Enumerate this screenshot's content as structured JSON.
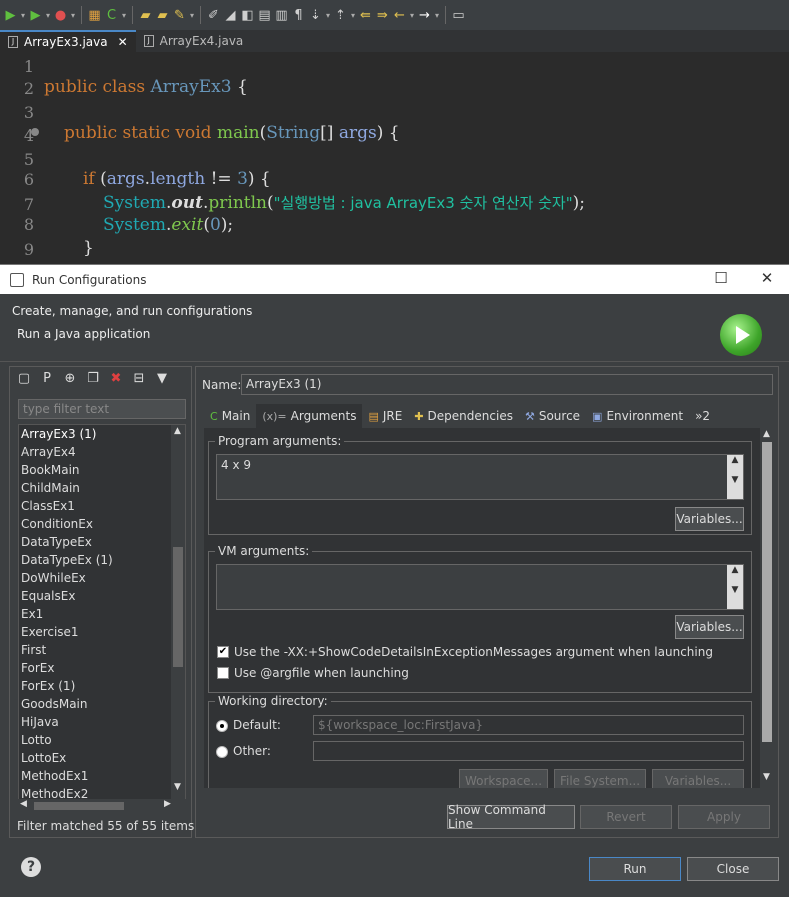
{
  "editor_tabs": [
    {
      "label": "ArrayEx3.java",
      "active": true,
      "close": "✕"
    },
    {
      "label": "ArrayEx4.java",
      "active": false
    }
  ],
  "code_lines": [
    "1",
    "2",
    "3",
    "4",
    "5",
    "6",
    "7",
    "8",
    "9"
  ],
  "code": {
    "l2_kw": "public class ",
    "l2_cls": "ArrayEx3",
    "l2_rest": " {",
    "l4_kw": "public static void ",
    "l4_fn": "main",
    "l4_p1": "(",
    "l4_type": "String",
    "l4_p2": "[] ",
    "l4_var": "args",
    "l4_p3": ") {",
    "l6_kw": "if ",
    "l6_p1": "(",
    "l6_var": "args",
    "l6_p2": ".",
    "l6_field": "length",
    "l6_op": " != ",
    "l6_num": "3",
    "l6_p3": ") {",
    "l7_cls": "System",
    "l7_d1": ".",
    "l7_out": "out",
    "l7_d2": ".",
    "l7_fn": "println",
    "l7_p1": "(",
    "l7_str": "\"실행방법 : java ArrayEx3 숫자 연산자 숫자\"",
    "l7_p2": ");",
    "l8_cls": "System",
    "l8_d": ".",
    "l8_fn": "exit",
    "l8_p1": "(",
    "l8_num": "0",
    "l8_p2": ");",
    "l9": "}"
  },
  "dialog": {
    "title": "Run Configurations",
    "header_title": "Create, manage, and run configurations",
    "header_sub": "Run a Java application",
    "filter_placeholder": "type filter text",
    "configs": [
      "ArrayEx3 (1)",
      "ArrayEx4",
      "BookMain",
      "ChildMain",
      "ClassEx1",
      "ConditionEx",
      "DataTypeEx",
      "DataTypeEx (1)",
      "DoWhileEx",
      "EqualsEx",
      "Ex1",
      "Exercise1",
      "First",
      "ForEx",
      "ForEx (1)",
      "GoodsMain",
      "HiJava",
      "Lotto",
      "LottoEx",
      "MethodEx1",
      "MethodEx2"
    ],
    "filter_status": "Filter matched 55 of 55 items",
    "name_label": "Name:",
    "name_value": "ArrayEx3 (1)",
    "tabs": [
      {
        "label": "Main",
        "icon": "C"
      },
      {
        "label": "Arguments",
        "icon": "(x)="
      },
      {
        "label": "JRE",
        "icon": "▤"
      },
      {
        "label": "Dependencies",
        "icon": "✚"
      },
      {
        "label": "Source",
        "icon": "⚒"
      },
      {
        "label": "Environment",
        "icon": "▣"
      },
      {
        "label": "»2",
        "icon": ""
      }
    ],
    "program_args_label": "Program arguments:",
    "program_args_value": "4 x 9",
    "variables_label": "Variables...",
    "vm_args_label": "VM arguments:",
    "vm_args_value": "",
    "chk_showcode": "Use the -XX:+ShowCodeDetailsInExceptionMessages argument when launching",
    "chk_argfile": "Use @argfile when launching",
    "working_dir_label": "Working directory:",
    "default_label": "Default:",
    "default_value": "${workspace_loc:FirstJava}",
    "other_label": "Other:",
    "workspace_btn": "Workspace...",
    "filesystem_btn": "File System...",
    "variables_btn2": "Variables...",
    "show_cmd": "Show Command Line",
    "revert": "Revert",
    "apply": "Apply",
    "run": "Run",
    "close": "Close",
    "help": "?"
  }
}
